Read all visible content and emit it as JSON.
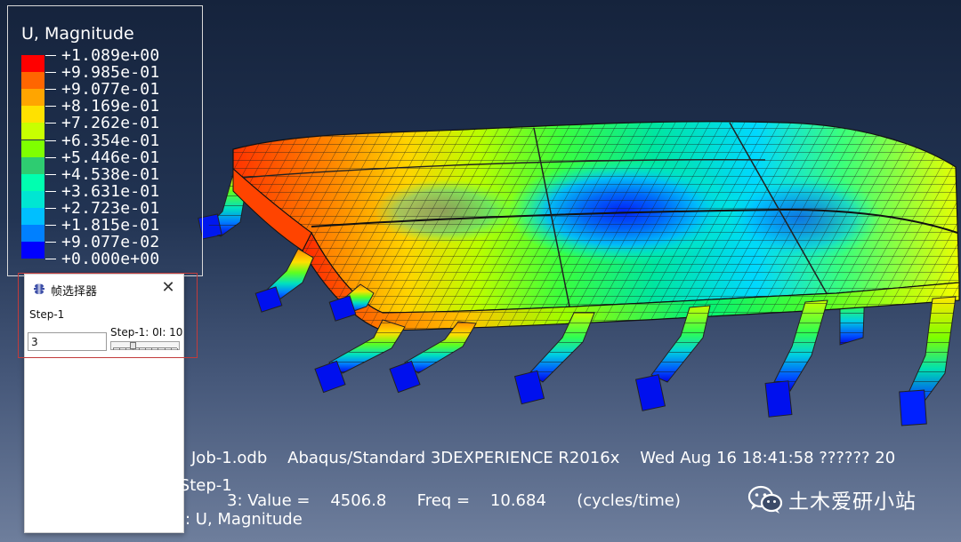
{
  "legend": {
    "title": "U, Magnitude",
    "colors": [
      "#ff0000",
      "#ff6600",
      "#ffa500",
      "#ffe100",
      "#c8ff00",
      "#7fff00",
      "#2ecc71",
      "#00ffb0",
      "#00e6d2",
      "#00bfff",
      "#0080ff",
      "#0000ff"
    ],
    "values": [
      "+1.089e+00",
      "+9.985e-01",
      "+9.077e-01",
      "+8.169e-01",
      "+7.262e-01",
      "+6.354e-01",
      "+5.446e-01",
      "+4.538e-01",
      "+3.631e-01",
      "+2.723e-01",
      "+1.815e-01",
      "+9.077e-02",
      "+0.000e+00"
    ]
  },
  "dialog": {
    "title": "帧选择器",
    "close_label": "✕",
    "step_label": "Step-1",
    "frame_value": "3",
    "slider_label": "Step-1: 0I: 10",
    "slider_min": 0,
    "slider_max": 10,
    "slider_value": 3
  },
  "status": {
    "line1": "Job-1.odb    Abaqus/Standard 3DEXPERIENCE R2016x    Wed Aug 16 18:41:58 ?????? 20",
    "line2": "步: Step-1",
    "line3": "3: Value =    4506.8      Freq =    10.684      (cycles/time)",
    "line4": ": U, Magnitude"
  },
  "watermark": {
    "icon": "wechat-icon",
    "text": "土木爱研小站"
  }
}
